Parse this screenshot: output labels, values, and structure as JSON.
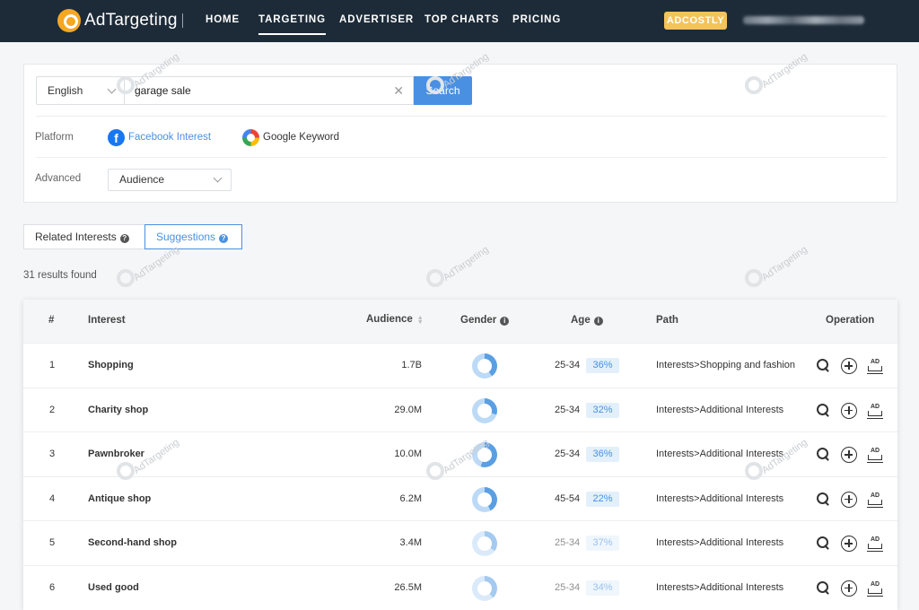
{
  "nav": {
    "logo_text": "AdTargeting",
    "items": [
      "HOME",
      "TARGETING",
      "ADVERTISER",
      "TOP CHARTS",
      "PRICING"
    ],
    "active": "TARGETING",
    "adcostly": "ADCOSTLY"
  },
  "search": {
    "language": "English",
    "query": "garage sale",
    "button": "Search"
  },
  "platform": {
    "label": "Platform",
    "facebook": "Facebook Interest",
    "google": "Google Keyword"
  },
  "advanced": {
    "label": "Advanced",
    "value": "Audience"
  },
  "tabs": [
    "Related Interests",
    "Suggestions"
  ],
  "results_text": "31 results found",
  "table": {
    "headers": {
      "num": "#",
      "interest": "Interest",
      "audience": "Audience",
      "gender": "Gender",
      "age": "Age",
      "path": "Path",
      "operation": "Operation"
    },
    "rows": [
      {
        "num": "1",
        "interest": "Shopping",
        "audience": "1.7B",
        "age_range": "25-34",
        "age_pct": "36%",
        "path": "Interests>Shopping and fashion",
        "male_pct": 40
      },
      {
        "num": "2",
        "interest": "Charity shop",
        "audience": "29.0M",
        "age_range": "25-34",
        "age_pct": "32%",
        "path": "Interests>Additional Interests",
        "male_pct": 30
      },
      {
        "num": "3",
        "interest": "Pawnbroker",
        "audience": "10.0M",
        "age_range": "25-34",
        "age_pct": "36%",
        "path": "Interests>Additional Interests",
        "male_pct": 55
      },
      {
        "num": "4",
        "interest": "Antique shop",
        "audience": "6.2M",
        "age_range": "45-54",
        "age_pct": "22%",
        "path": "Interests>Additional Interests",
        "male_pct": 42
      },
      {
        "num": "5",
        "interest": "Second-hand shop",
        "audience": "3.4M",
        "age_range": "25-34",
        "age_pct": "37%",
        "path": "Interests>Additional Interests",
        "male_pct": 35
      },
      {
        "num": "6",
        "interest": "Used good",
        "audience": "26.5M",
        "age_range": "25-34",
        "age_pct": "34%",
        "path": "Interests>Additional Interests",
        "male_pct": 38
      }
    ]
  },
  "watermark": "AdTargeting",
  "colors": {
    "topbar": "#1d2b38",
    "accent": "#4a90e2",
    "adcostly": "#f5c25b",
    "donut_dark": "#5b9fe3",
    "donut_light": "#bcdaf6"
  }
}
